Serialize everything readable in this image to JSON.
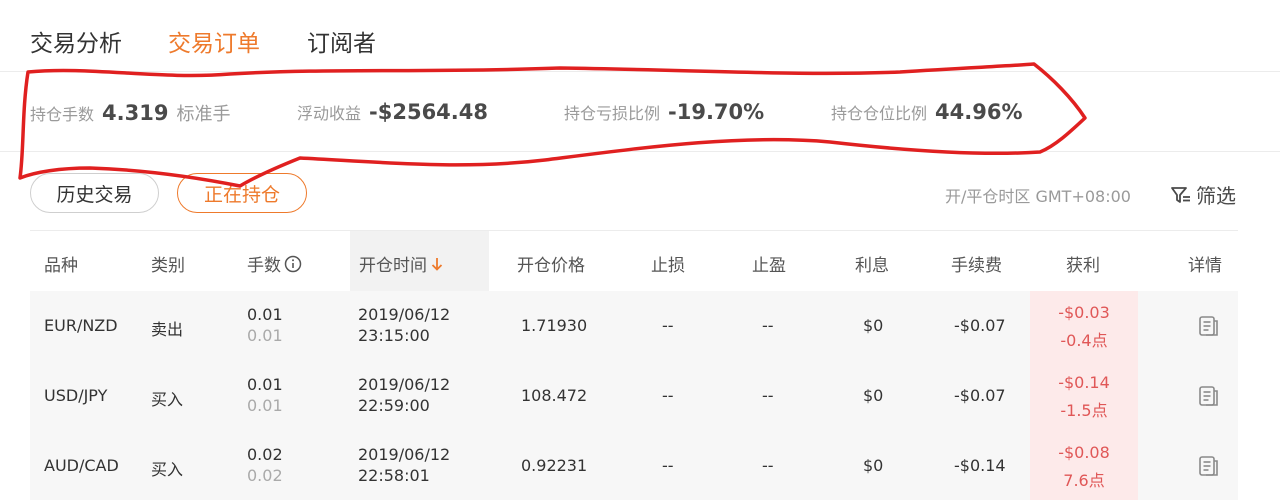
{
  "tabs": [
    {
      "label": "交易分析"
    },
    {
      "label": "交易订单",
      "active": true
    },
    {
      "label": "订阅者"
    }
  ],
  "stats": {
    "lots": {
      "label": "持仓手数",
      "value": "4.319",
      "unit": "标准手"
    },
    "floating": {
      "label": "浮动收益",
      "value": "-$2564.48"
    },
    "loss_ratio": {
      "label": "持仓亏损比例",
      "value": "-19.70%"
    },
    "position_ratio": {
      "label": "持仓仓位比例",
      "value": "44.96%"
    }
  },
  "pills": {
    "history": "历史交易",
    "open": "正在持仓"
  },
  "timezone": "开/平仓时区 GMT+08:00",
  "filter_label": "筛选",
  "columns": {
    "symbol": "品种",
    "type": "类别",
    "lots": "手数",
    "open_time": "开仓时间",
    "open_price": "开仓价格",
    "stop_loss": "止损",
    "take_profit": "止盈",
    "interest": "利息",
    "fee": "手续费",
    "profit": "获利",
    "detail": "详情"
  },
  "rows": [
    {
      "symbol": "EUR/NZD",
      "type": "卖出",
      "lots": "0.01",
      "lots_sub": "0.01",
      "date": "2019/06/12",
      "time": "23:15:00",
      "open_price": "1.71930",
      "stop_loss": "--",
      "take_profit": "--",
      "interest": "$0",
      "fee": "-$0.07",
      "profit": "-$0.03",
      "points": "-0.4点"
    },
    {
      "symbol": "USD/JPY",
      "type": "买入",
      "lots": "0.01",
      "lots_sub": "0.01",
      "date": "2019/06/12",
      "time": "22:59:00",
      "open_price": "108.472",
      "stop_loss": "--",
      "take_profit": "--",
      "interest": "$0",
      "fee": "-$0.07",
      "profit": "-$0.14",
      "points": "-1.5点"
    },
    {
      "symbol": "AUD/CAD",
      "type": "买入",
      "lots": "0.02",
      "lots_sub": "0.02",
      "date": "2019/06/12",
      "time": "22:58:01",
      "open_price": "0.92231",
      "stop_loss": "--",
      "take_profit": "--",
      "interest": "$0",
      "fee": "-$0.14",
      "profit": "-$0.08",
      "points": "7.6点"
    }
  ],
  "colors": {
    "accent": "#ee7a2c",
    "loss": "#e05757",
    "annotation": "#e02020"
  }
}
